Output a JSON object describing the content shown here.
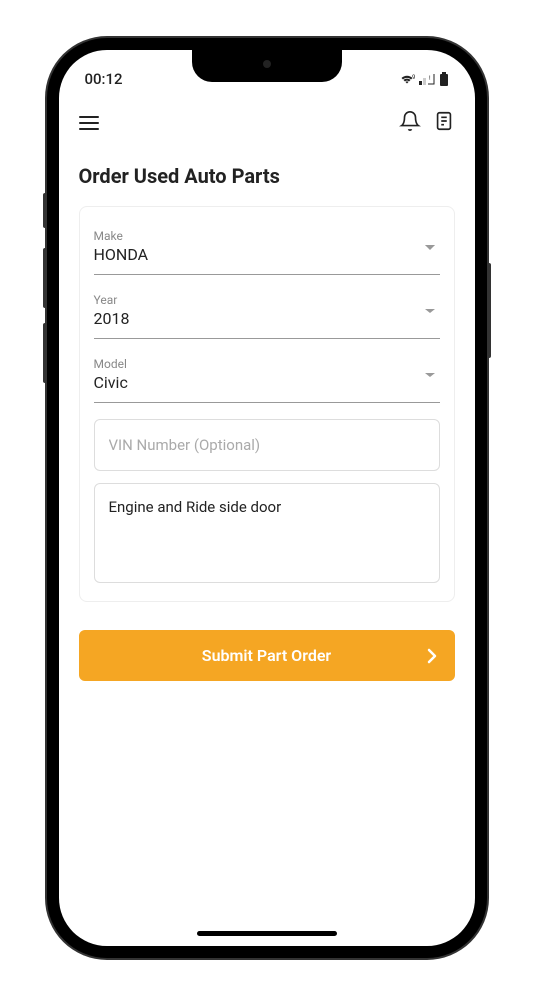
{
  "status_bar": {
    "time": "00:12"
  },
  "page": {
    "title": "Order Used Auto Parts"
  },
  "form": {
    "make": {
      "label": "Make",
      "value": "HONDA"
    },
    "year": {
      "label": "Year",
      "value": "2018"
    },
    "model": {
      "label": "Model",
      "value": "Civic"
    },
    "vin": {
      "placeholder": "VIN Number (Optional)",
      "value": ""
    },
    "description": {
      "value": "Engine and Ride side door"
    }
  },
  "submit": {
    "label": "Submit Part Order"
  }
}
